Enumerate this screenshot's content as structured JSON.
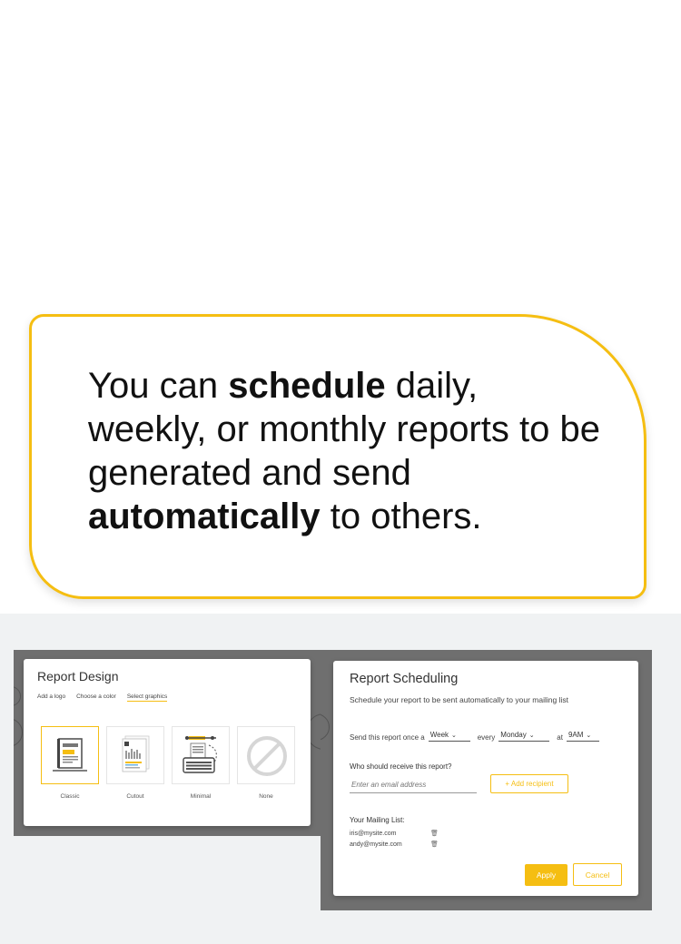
{
  "callout": {
    "seg1": "You can ",
    "seg2": "schedule",
    "seg3": " daily, weekly, or monthly reports to be generated and send ",
    "seg4": "automatically",
    "seg5": " to others."
  },
  "design": {
    "title": "Report Design",
    "tabs": [
      "Add a logo",
      "Choose a color",
      "Select graphics"
    ],
    "active_tab": "Select graphics",
    "options": [
      {
        "label": "Classic",
        "icon": "classic-report-icon",
        "selected": true
      },
      {
        "label": "Cutout",
        "icon": "cutout-report-icon",
        "selected": false
      },
      {
        "label": "Minimal",
        "icon": "typewriter-icon",
        "selected": false
      },
      {
        "label": "None",
        "icon": "no-graphic-icon",
        "selected": false
      }
    ]
  },
  "scheduling": {
    "title": "Report Scheduling",
    "subtitle": "Schedule your report to be sent automatically to your mailing list",
    "send_prefix": "Send this report once a",
    "period": "Week",
    "every_label": "every",
    "day": "Monday",
    "at_label": "at",
    "time": "9AM",
    "who_label": "Who should receive this report?",
    "email_placeholder": "Enter an email address",
    "add_recipient": "+ Add recipient",
    "mailing_list_label": "Your Mailing List:",
    "mailing_list": [
      "iris@mysite.com",
      "andy@mysite.com"
    ],
    "apply": "Apply",
    "cancel": "Cancel"
  },
  "colors": {
    "accent": "#f5be12",
    "overlay": "#6f6f6f",
    "background": "#f0f2f3"
  }
}
